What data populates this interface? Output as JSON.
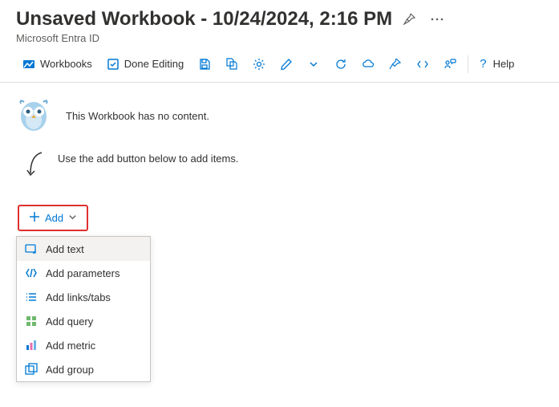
{
  "header": {
    "title": "Unsaved Workbook - 10/24/2024, 2:16 PM",
    "subtitle": "Microsoft Entra ID"
  },
  "toolbar": {
    "workbooks": "Workbooks",
    "done_editing": "Done Editing",
    "help": "Help"
  },
  "empty_state": {
    "no_content": "This Workbook has no content.",
    "use_add": "Use the add button below to add items."
  },
  "add_button": {
    "label": "Add"
  },
  "add_menu": {
    "items": [
      {
        "label": "Add text"
      },
      {
        "label": "Add parameters"
      },
      {
        "label": "Add links/tabs"
      },
      {
        "label": "Add query"
      },
      {
        "label": "Add metric"
      },
      {
        "label": "Add group"
      }
    ]
  }
}
